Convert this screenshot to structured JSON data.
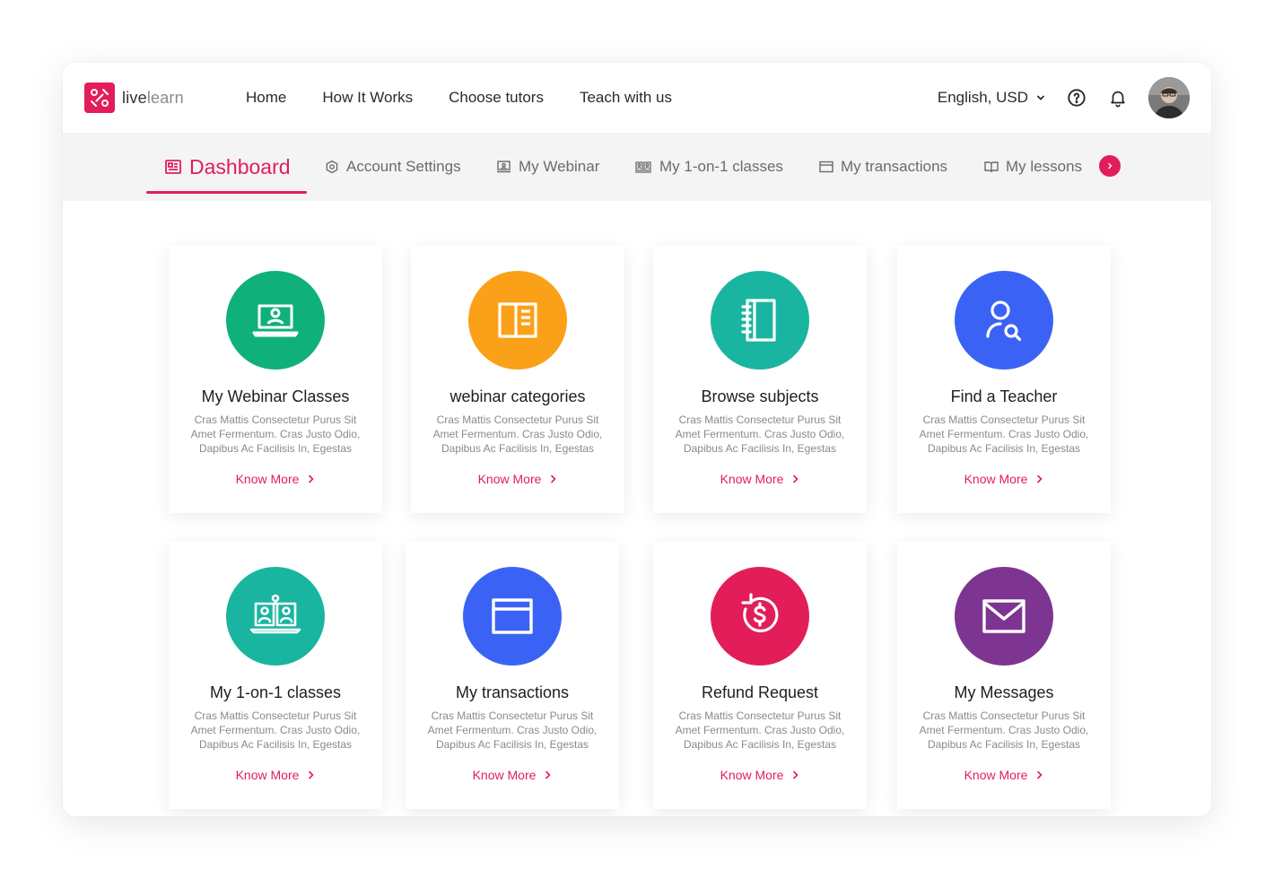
{
  "brand": {
    "name_bold": "live",
    "name_light": "learn",
    "color": "#e21d5a"
  },
  "nav": {
    "items": [
      {
        "label": "Home"
      },
      {
        "label": "How It Works"
      },
      {
        "label": "Choose tutors"
      },
      {
        "label": "Teach with us"
      }
    ]
  },
  "header": {
    "locale": "English, USD",
    "icons": [
      "help-icon",
      "bell-icon"
    ]
  },
  "tabs": [
    {
      "label": "Dashboard",
      "icon": "dashboard-icon",
      "active": true
    },
    {
      "label": "Account Settings",
      "icon": "settings-icon",
      "active": false
    },
    {
      "label": "My Webinar",
      "icon": "webinar-icon",
      "active": false
    },
    {
      "label": "My 1-on-1 classes",
      "icon": "classes-icon",
      "active": false
    },
    {
      "label": "My transactions",
      "icon": "card-icon",
      "active": false
    },
    {
      "label": "My lessons",
      "icon": "book-icon",
      "active": false
    }
  ],
  "cards": [
    {
      "title": "My Webinar Classes",
      "desc": "Cras Mattis Consectetur Purus Sit Amet Fermentum. Cras Justo Odio, Dapibus Ac Facilisis In, Egestas",
      "link": "Know More",
      "color": "#10b07a",
      "icon": "laptop-user-icon"
    },
    {
      "title": "webinar categories",
      "desc": "Cras Mattis Consectetur Purus Sit Amet Fermentum. Cras Justo Odio, Dapibus Ac Facilisis In, Egestas",
      "link": "Know More",
      "color": "#fba119",
      "icon": "layout-icon"
    },
    {
      "title": "Browse subjects",
      "desc": "Cras Mattis Consectetur Purus Sit Amet Fermentum. Cras Justo Odio, Dapibus Ac Facilisis In, Egestas",
      "link": "Know More",
      "color": "#1ab5a0",
      "icon": "notebook-icon"
    },
    {
      "title": "Find a Teacher",
      "desc": "Cras Mattis Consectetur Purus Sit Amet Fermentum. Cras Justo Odio, Dapibus Ac Facilisis In, Egestas",
      "link": "Know More",
      "color": "#3a63f6",
      "icon": "user-search-icon"
    },
    {
      "title": "My 1-on-1 classes",
      "desc": "Cras Mattis Consectetur Purus Sit Amet Fermentum. Cras Justo Odio, Dapibus Ac Facilisis In, Egestas",
      "link": "Know More",
      "color": "#1ab5a0",
      "icon": "one-on-one-icon"
    },
    {
      "title": "My transactions",
      "desc": "Cras Mattis Consectetur Purus Sit Amet Fermentum. Cras Justo Odio, Dapibus Ac Facilisis In, Egestas",
      "link": "Know More",
      "color": "#3a63f6",
      "icon": "card-icon"
    },
    {
      "title": "Refund Request",
      "desc": "Cras Mattis Consectetur Purus Sit Amet Fermentum. Cras Justo Odio, Dapibus Ac Facilisis In, Egestas",
      "link": "Know More",
      "color": "#e21d5a",
      "icon": "refund-icon"
    },
    {
      "title": "My Messages",
      "desc": "Cras Mattis Consectetur Purus Sit Amet Fermentum. Cras Justo Odio, Dapibus Ac Facilisis In, Egestas",
      "link": "Know More",
      "color": "#7e3591",
      "icon": "mail-icon"
    }
  ]
}
